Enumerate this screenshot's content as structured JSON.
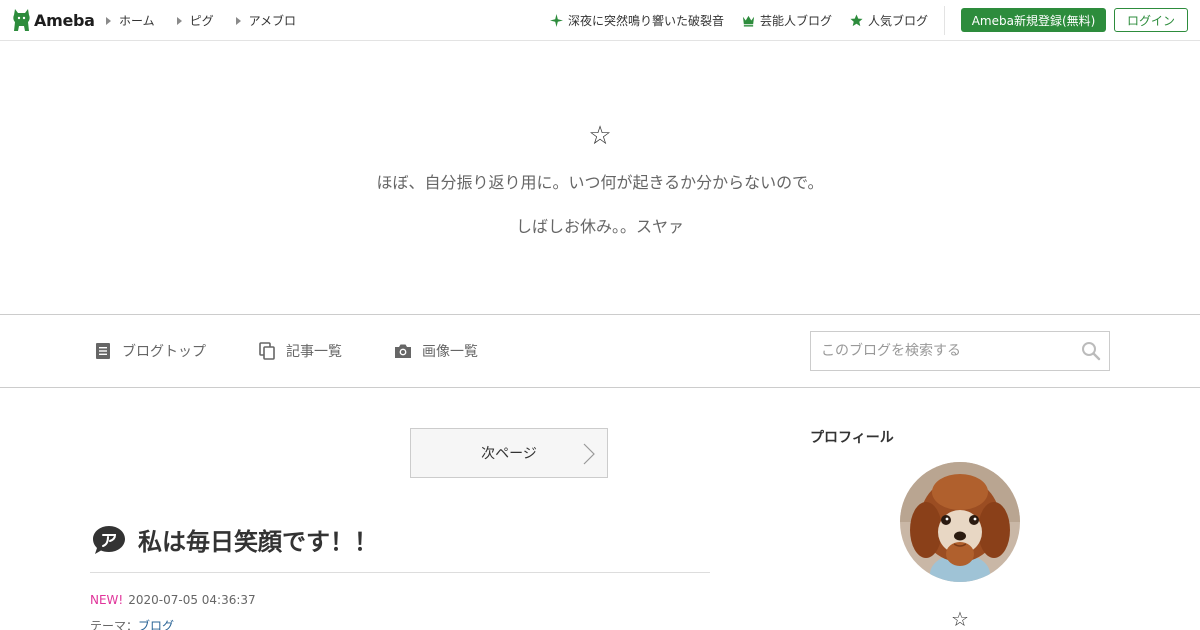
{
  "header": {
    "logo_text": "Ameba",
    "nav": [
      {
        "label": "ホーム"
      },
      {
        "label": "ピグ"
      },
      {
        "label": "アメブロ"
      }
    ],
    "links": [
      {
        "label": "深夜に突然鳴り響いた破裂音",
        "icon": "sparkle-icon"
      },
      {
        "label": "芸能人ブログ",
        "icon": "crown-icon"
      },
      {
        "label": "人気ブログ",
        "icon": "star-icon"
      }
    ],
    "register_label": "Ameba新規登録(無料)",
    "login_label": "ログイン",
    "accent_color": "#2d8c3c"
  },
  "blog": {
    "title": "☆",
    "description": "ほぼ、自分振り返り用に。いつ何が起きるか分からないので。",
    "description2": "しばしお休み。。スヤァ"
  },
  "blognav": {
    "items": [
      {
        "label": "ブログトップ",
        "icon": "document-icon"
      },
      {
        "label": "記事一覧",
        "icon": "copy-icon"
      },
      {
        "label": "画像一覧",
        "icon": "camera-icon"
      }
    ],
    "search_placeholder": "このブログを検索する"
  },
  "main": {
    "next_page_label": "次ページ",
    "entry": {
      "title": "私は毎日笑顔です！！",
      "new_label": "NEW!",
      "date": "2020-07-05 04:36:37",
      "theme_label": "テーマ：",
      "theme_value": "ブログ"
    }
  },
  "sidebar": {
    "profile_title": "プロフィール",
    "profile_name": "☆"
  }
}
